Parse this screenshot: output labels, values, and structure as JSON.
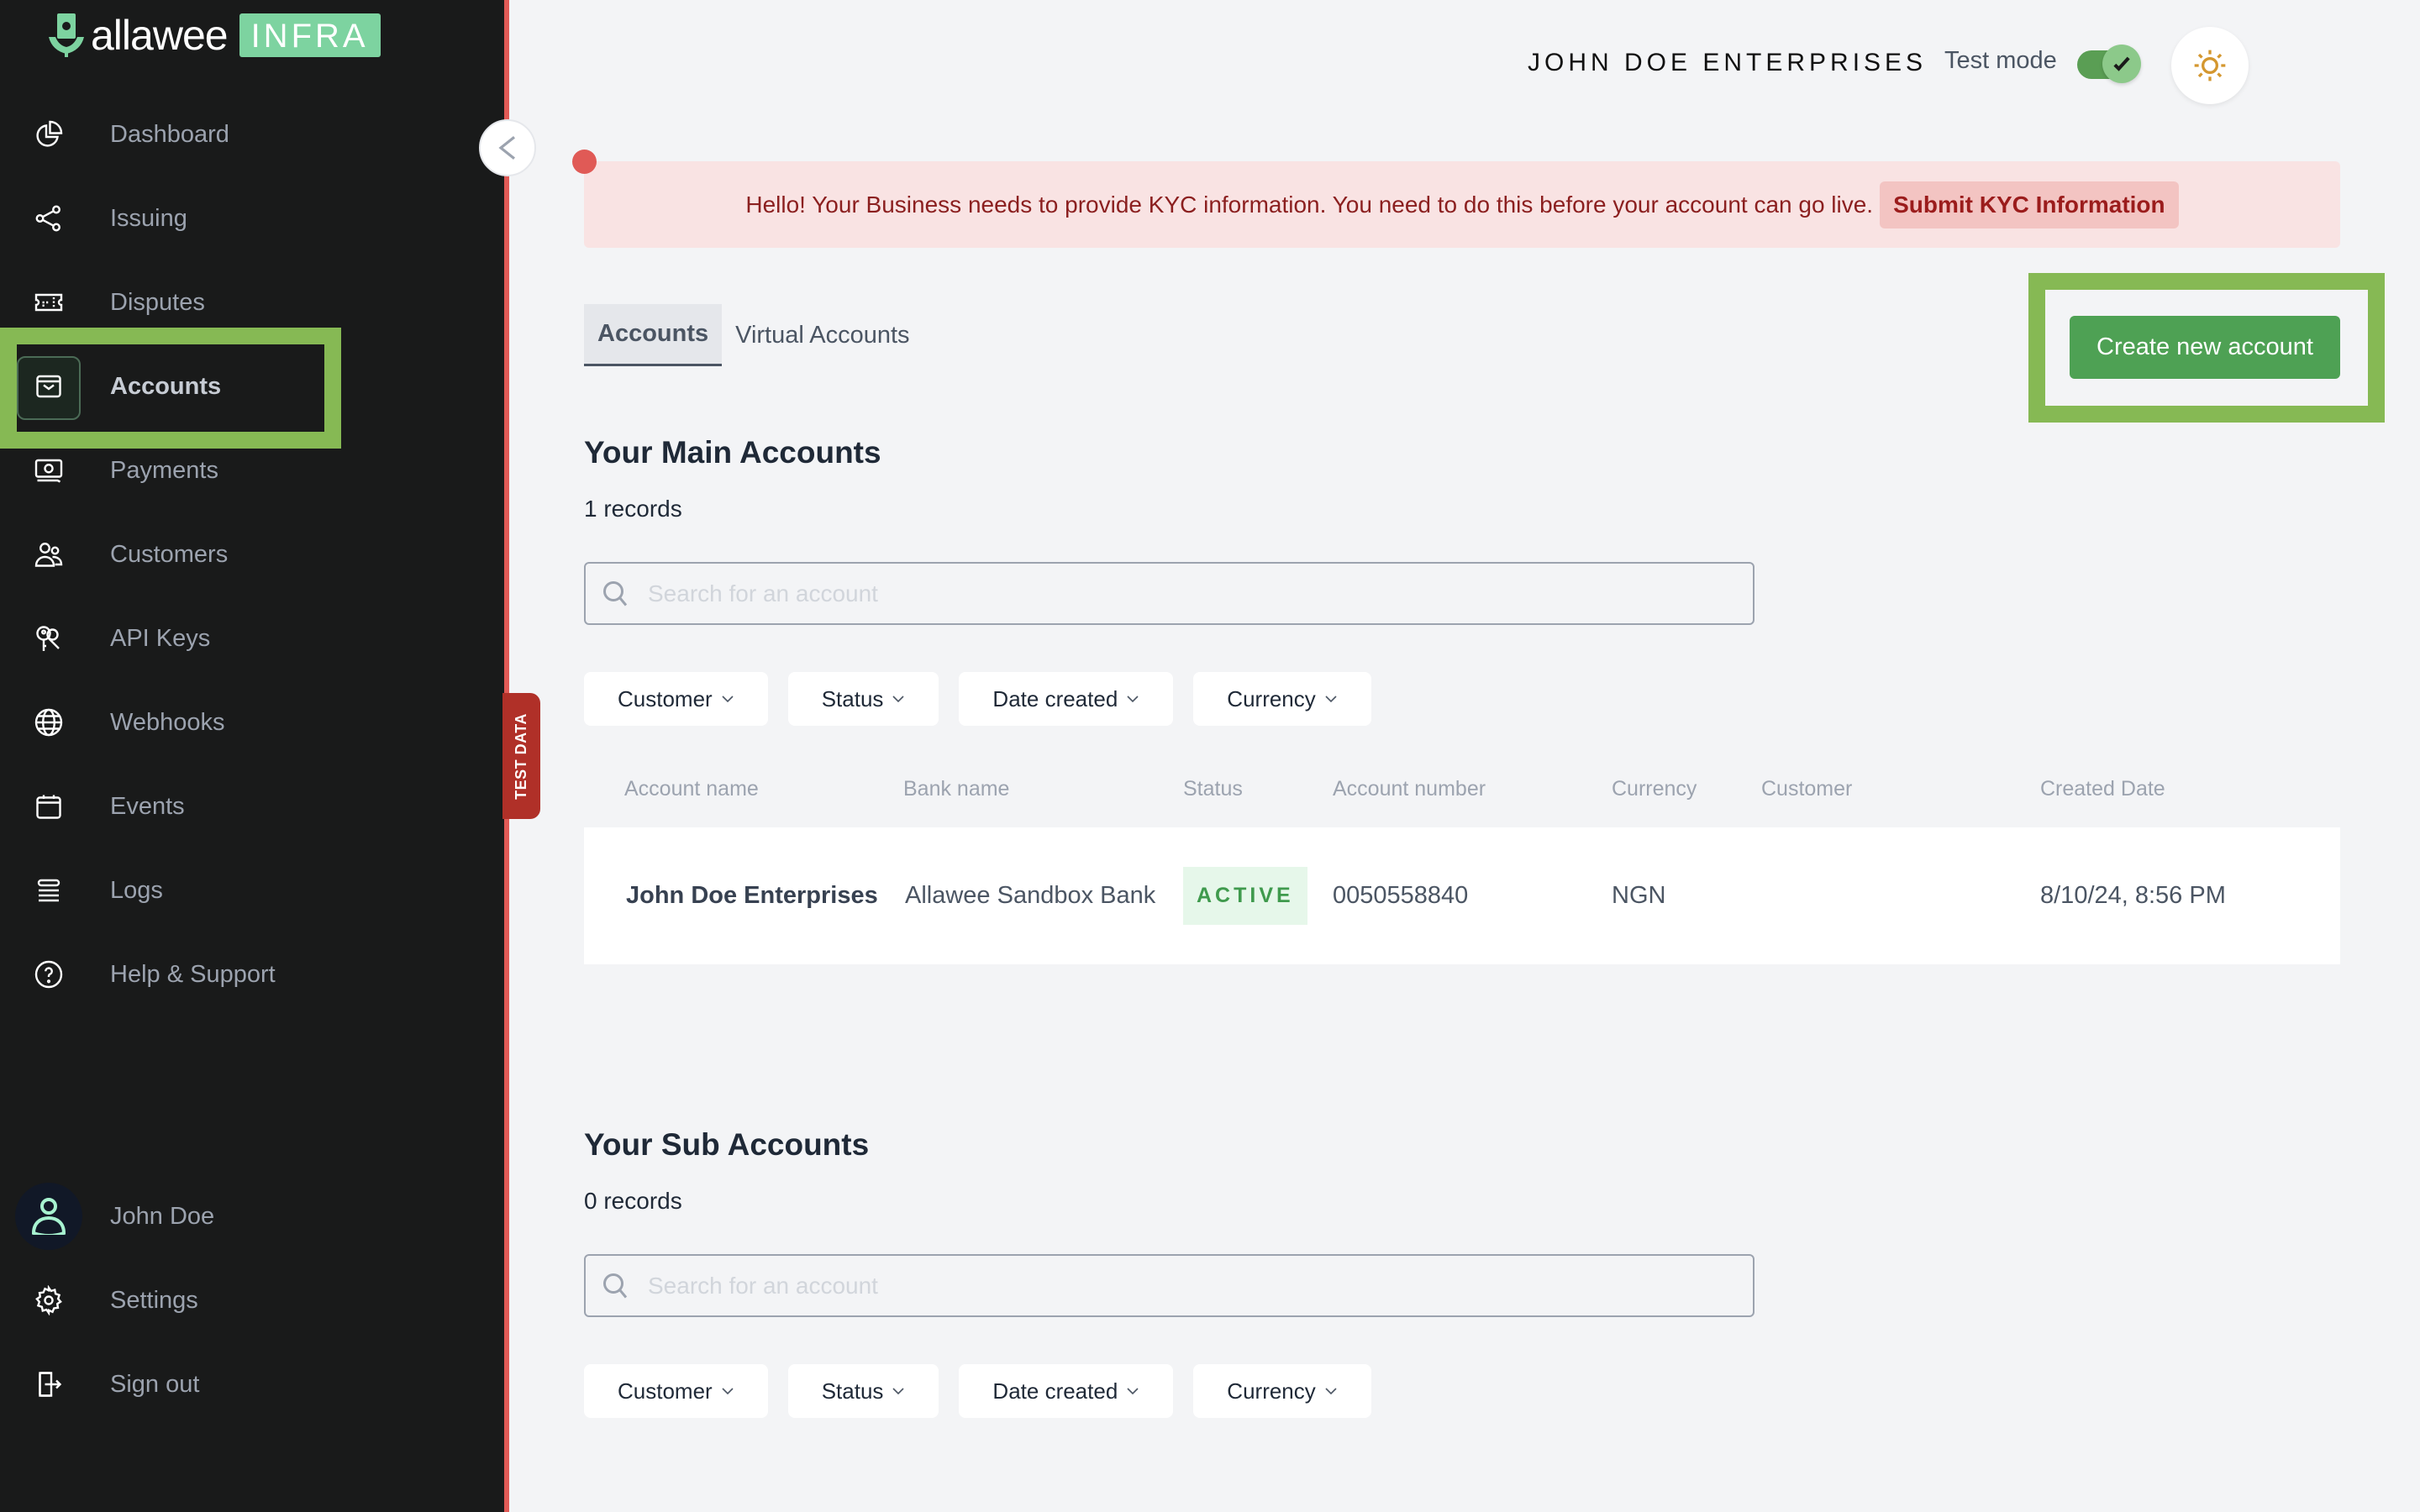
{
  "brand": {
    "name": "allawee",
    "badge": "INFRA",
    "accent": "#7dd3a0"
  },
  "sidebar": {
    "items": [
      {
        "label": "Dashboard",
        "icon": "pie-chart-icon"
      },
      {
        "label": "Issuing",
        "icon": "share-icon"
      },
      {
        "label": "Disputes",
        "icon": "ticket-icon"
      },
      {
        "label": "Accounts",
        "icon": "wallet-icon",
        "active": true
      },
      {
        "label": "Payments",
        "icon": "money-icon"
      },
      {
        "label": "Customers",
        "icon": "users-icon"
      },
      {
        "label": "API Keys",
        "icon": "key-icon"
      },
      {
        "label": "Webhooks",
        "icon": "globe-icon"
      },
      {
        "label": "Events",
        "icon": "calendar-icon"
      },
      {
        "label": "Logs",
        "icon": "list-icon"
      },
      {
        "label": "Help & Support",
        "icon": "help-icon"
      }
    ],
    "user": {
      "name": "John Doe"
    },
    "settings_label": "Settings",
    "signout_label": "Sign out",
    "test_data_label": "TEST DATA"
  },
  "header": {
    "company": "JOHN DOE ENTERPRISES",
    "test_mode_label": "Test mode",
    "test_mode_on": true
  },
  "banner": {
    "text": "Hello! Your Business needs to provide KYC information. You need to do this before your account can go live.",
    "button": "Submit KYC Information"
  },
  "tabs": [
    {
      "label": "Accounts",
      "active": true
    },
    {
      "label": "Virtual Accounts",
      "active": false
    }
  ],
  "create_button": "Create new account",
  "main_accounts": {
    "title": "Your Main Accounts",
    "records": "1 records",
    "search_placeholder": "Search for an account",
    "filters": [
      "Customer",
      "Status",
      "Date created",
      "Currency"
    ],
    "columns": [
      "Account name",
      "Bank name",
      "Status",
      "Account number",
      "Currency",
      "Customer",
      "Created Date"
    ],
    "rows": [
      {
        "account_name": "John Doe Enterprises",
        "bank_name": "Allawee Sandbox Bank",
        "status": "ACTIVE",
        "account_number": "0050558840",
        "currency": "NGN",
        "customer": "",
        "created_date": "8/10/24, 8:56 PM"
      }
    ]
  },
  "sub_accounts": {
    "title": "Your Sub Accounts",
    "records": "0 records",
    "search_placeholder": "Search for an account",
    "filters": [
      "Customer",
      "Status",
      "Date created",
      "Currency"
    ]
  }
}
